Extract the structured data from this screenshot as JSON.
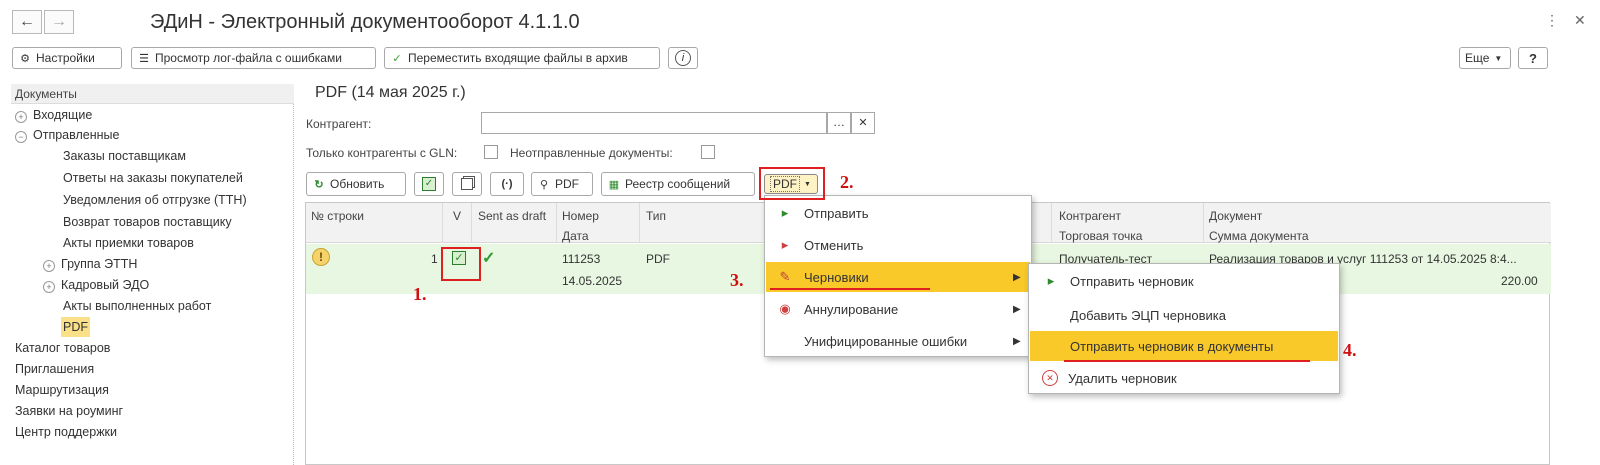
{
  "window": {
    "title": "ЭДиН - Электронный документооборот 4.1.1.0",
    "back_icon": "arrow-left-icon",
    "forward_icon": "arrow-right-icon"
  },
  "toolbar": {
    "settings": "Настройки",
    "log_view": "Просмотр лог-файла с ошибками",
    "move_archive": "Переместить входящие файлы в архив",
    "more": "Еще",
    "help": "?"
  },
  "sidebar": {
    "header": "Документы",
    "items": [
      "Входящие",
      "Отправленные",
      "Заказы поставщикам",
      "Ответы на заказы покупателей",
      "Уведомления об отгрузке (ТТН)",
      "Возврат товаров поставщику",
      "Акты приемки товаров",
      "Группа ЭТТН",
      "Кадровый ЭДО",
      "Акты выполненных работ",
      "PDF",
      "Каталог товаров",
      "Приглашения",
      "Маршрутизация",
      "Заявки на роуминг",
      "Центр поддержки"
    ]
  },
  "main": {
    "title": "PDF (14 мая 2025 г.)",
    "counterparty_label": "Контрагент:",
    "counterparty_value": "",
    "gln_label": "Только контрагенты с GLN:",
    "unsent_label": "Неотправленные документы:",
    "refresh": "Обновить",
    "pdf_view": "PDF",
    "registry": "Реестр сообщений",
    "pdf_menu": "PDF"
  },
  "grid": {
    "headers": [
      "№ строки",
      "V",
      "Sent as draft",
      "Номер",
      "Тип",
      "Контрагент",
      "Документ"
    ],
    "headers2": [
      "Дата",
      "Торговая точка",
      "Сумма документа"
    ],
    "row": {
      "line": "1",
      "number": "111253",
      "date": "14.05.2025",
      "type": "PDF",
      "counterparty": "Получатель-тест",
      "document": "Реализация товаров и услуг 111253 от 14.05.2025 8:4...",
      "amount": "220.00"
    }
  },
  "menu": {
    "items": [
      "Отправить",
      "Отменить",
      "Черновики",
      "Аннулирование",
      "Унифицированные ошибки"
    ]
  },
  "submenu": {
    "items": [
      "Отправить черновик",
      "Добавить ЭЦП черновика",
      "Отправить черновик в документы",
      "Удалить черновик"
    ]
  },
  "annotations": [
    "1.",
    "2.",
    "3.",
    "4."
  ],
  "colors": {
    "highlight": "#f9c92a",
    "selected_row": "#e8f7e1",
    "annotation": "#e02020",
    "sidebar_selected": "#fbe08a"
  }
}
